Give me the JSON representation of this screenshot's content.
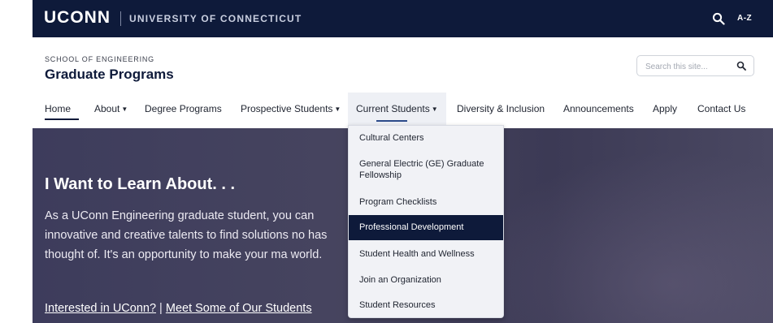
{
  "brand": {
    "logo": "UCONN",
    "university": "UNIVERSITY OF CONNECTICUT",
    "az": "A-Z"
  },
  "header": {
    "school": "SCHOOL OF ENGINEERING",
    "title": "Graduate Programs",
    "search_placeholder": "Search this site..."
  },
  "nav": {
    "items": [
      {
        "label": "Home"
      },
      {
        "label": "About"
      },
      {
        "label": "Degree Programs"
      },
      {
        "label": "Prospective Students"
      },
      {
        "label": "Current Students"
      },
      {
        "label": "Diversity & Inclusion"
      },
      {
        "label": "Announcements"
      },
      {
        "label": "Apply"
      },
      {
        "label": "Contact Us"
      }
    ]
  },
  "dropdown": {
    "items": [
      {
        "label": "Cultural Centers"
      },
      {
        "label": "General Electric (GE) Graduate Fellowship"
      },
      {
        "label": "Program Checklists"
      },
      {
        "label": "Professional Development"
      },
      {
        "label": "Student Health and Wellness"
      },
      {
        "label": "Join an Organization"
      },
      {
        "label": "Student Resources"
      }
    ]
  },
  "hero": {
    "title": "I Want to Learn About. . .",
    "text": "As a UConn Engineering graduate student, you can innovative and creative talents to find solutions no has thought of. It's an opportunity to make your ma world.",
    "link1": "Interested in UConn?",
    "separator": " | ",
    "link2": "Meet Some of Our Students"
  },
  "colors": {
    "navy": "#0e1a3a",
    "hero": "#3d3c5c",
    "dropdown_bg": "#f1f2f6"
  },
  "icons": {
    "search": "search-icon"
  }
}
